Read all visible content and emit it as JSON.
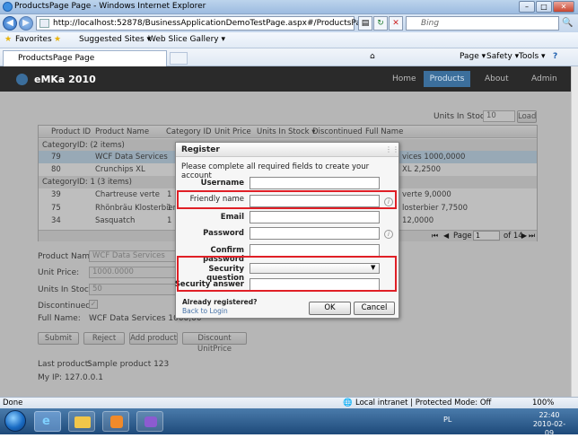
{
  "window": {
    "title": "ProductsPage Page - Windows Internet Explorer"
  },
  "address": {
    "url": "http://localhost:52878/BusinessApplicationDemoTestPage.aspx#/ProductsPage",
    "search_placeholder": "Bing"
  },
  "favorites": {
    "favorites_label": "Favorites",
    "suggested": "Suggested Sites ▾",
    "webslice": "Web Slice Gallery ▾"
  },
  "tab": {
    "label": "ProductsPage Page"
  },
  "commandbar": {
    "page": "Page ▾",
    "safety": "Safety ▾",
    "tools": "Tools ▾",
    "help": "?"
  },
  "app": {
    "name": "eMKa 2010",
    "nav": {
      "home": "Home",
      "products": "Products",
      "about": "About",
      "admin": "Admin"
    },
    "units_in_stock_label": "Units In Stock:",
    "units_in_stock_value": "10",
    "load_label": "Load",
    "grid": {
      "headers": [
        "Product ID",
        "Product Name",
        "Category ID",
        "Unit Price",
        "Units In Stock ▾",
        "Discontinued",
        "Full Name"
      ],
      "group1": "CategoryID: (2 items)",
      "group2": "CategoryID: 1 (3 items)",
      "rows": [
        {
          "id": "79",
          "name": "WCF Data Services",
          "full": "vices 1000,0000"
        },
        {
          "id": "80",
          "name": "Crunchips XL",
          "full": "XL 2,2500"
        },
        {
          "id": "39",
          "name": "Chartreuse verte",
          "cat": "1",
          "full": "verte 9,0000"
        },
        {
          "id": "75",
          "name": "Rhönbräu Klosterbier",
          "cat": "1",
          "full": "losterbier 7,7500"
        },
        {
          "id": "34",
          "name": "Sasquatch",
          "cat": "1",
          "full": "12,0000"
        }
      ],
      "pager": {
        "page_label": "Page",
        "page_value": "1",
        "of_label": "of 14"
      }
    },
    "form": {
      "product_name_label": "Product Name:",
      "product_name_value": "WCF Data Services",
      "unit_price_label": "Unit Price:",
      "unit_price_value": "1000.0000",
      "units_label": "Units In Stock:",
      "units_value": "50",
      "discontinued_label": "Discontinued:",
      "fullname_label": "Full Name:",
      "fullname_value": "WCF Data Services 1000,00"
    },
    "buttons": {
      "submit": "Submit",
      "reject": "Reject",
      "add": "Add product",
      "discount": "Discount UnitPrice"
    },
    "last_product_label": "Last product:",
    "last_product_value": "Sample product 123",
    "my_ip_label": "My IP:",
    "my_ip_value": "127.0.0.1"
  },
  "dialog": {
    "title": "Register",
    "instructions": "Please complete all required fields to create your account",
    "fields": {
      "username": "Username",
      "friendly": "Friendly name",
      "email": "Email",
      "password": "Password",
      "confirm": "Confirm password",
      "question": "Security question",
      "answer": "Security answer"
    },
    "info_icon": "i",
    "already": "Already registered?",
    "back": "Back to Login",
    "ok": "OK",
    "cancel": "Cancel"
  },
  "status": {
    "done": "Done",
    "zone": "Local intranet | Protected Mode: Off",
    "zoom": "100%"
  },
  "taskbar": {
    "lang": "PL",
    "time": "22:40",
    "date": "2010-02-09"
  },
  "colors": {
    "highlight_box": "#e01f26",
    "header_bg": "#2a2a2a",
    "nav_selected": "#3c6f9c"
  }
}
